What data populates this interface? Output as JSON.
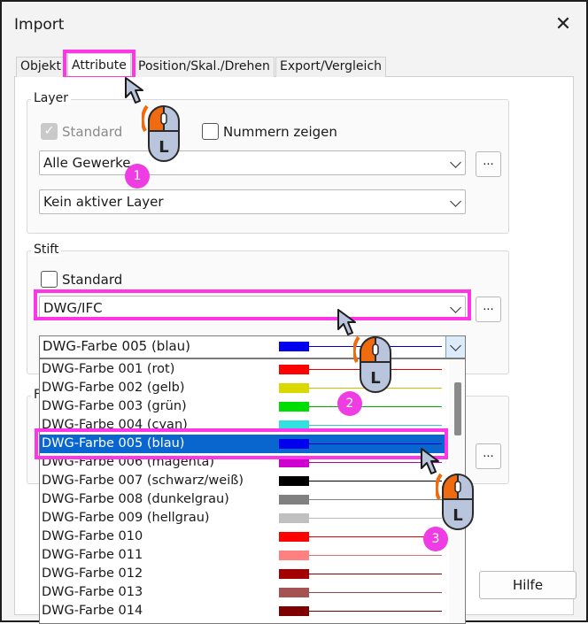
{
  "window": {
    "title": "Import",
    "close_icon": "close-icon"
  },
  "tabs": [
    "Objekt",
    "Attribute",
    "Position/Skal./Drehen",
    "Export/Vergleich"
  ],
  "layer": {
    "group_label": "Layer",
    "standard_label": "Standard",
    "nummern_label": "Nummern zeigen",
    "gewerke_value": "Alle Gewerke",
    "aktiver_value": "Kein aktiver Layer",
    "browse_label": "..."
  },
  "stift": {
    "group_label": "Stift",
    "standard_label": "Standard",
    "source_value": "DWG/IFC",
    "browse_label": "...",
    "color_value": "DWG-Farbe 005 (blau)",
    "color_swatch": "#0000ee"
  },
  "hidden_group_label": "F",
  "color_list": [
    {
      "label": "DWG-Farbe 001 (rot)",
      "color": "#ff0000",
      "line": "#e00000"
    },
    {
      "label": "DWG-Farbe 002 (gelb)",
      "color": "#d9d900",
      "line": "#d0c000"
    },
    {
      "label": "DWG-Farbe 003 (grün)",
      "color": "#00dd00",
      "line": "#00b000"
    },
    {
      "label": "DWG-Farbe 004 (cyan)",
      "color": "#33e0e0",
      "line": "#30c8c8"
    },
    {
      "label": "DWG-Farbe 005 (blau)",
      "color": "#0000ee",
      "line": "#0000cc"
    },
    {
      "label": "DWG-Farbe 006 (magenta)",
      "color": "#d000d0",
      "line": "#b000b0"
    },
    {
      "label": "DWG-Farbe 007 (schwarz/weiß)",
      "color": "#000000",
      "line": "#000000"
    },
    {
      "label": "DWG-Farbe 008 (dunkelgrau)",
      "color": "#808080",
      "line": "#808080"
    },
    {
      "label": "DWG-Farbe 009 (hellgrau)",
      "color": "#c0c0c0",
      "line": "#b8b8b8"
    },
    {
      "label": "DWG-Farbe 010",
      "color": "#ff0000",
      "line": "#e00000"
    },
    {
      "label": "DWG-Farbe 011",
      "color": "#ff8080",
      "line": "#e07070"
    },
    {
      "label": "DWG-Farbe 012",
      "color": "#a50000",
      "line": "#900000"
    },
    {
      "label": "DWG-Farbe 013",
      "color": "#a55252",
      "line": "#904848"
    },
    {
      "label": "DWG-Farbe 014",
      "color": "#7f0000",
      "line": "#700000"
    }
  ],
  "selected_index": 4,
  "badges": [
    "1",
    "2",
    "3"
  ],
  "mouse_button_label": "L",
  "help_label": "Hilfe",
  "colors": {
    "highlight": "#ff36e8",
    "selection": "#0a66cf",
    "mouse_orange": "#f06a10"
  }
}
